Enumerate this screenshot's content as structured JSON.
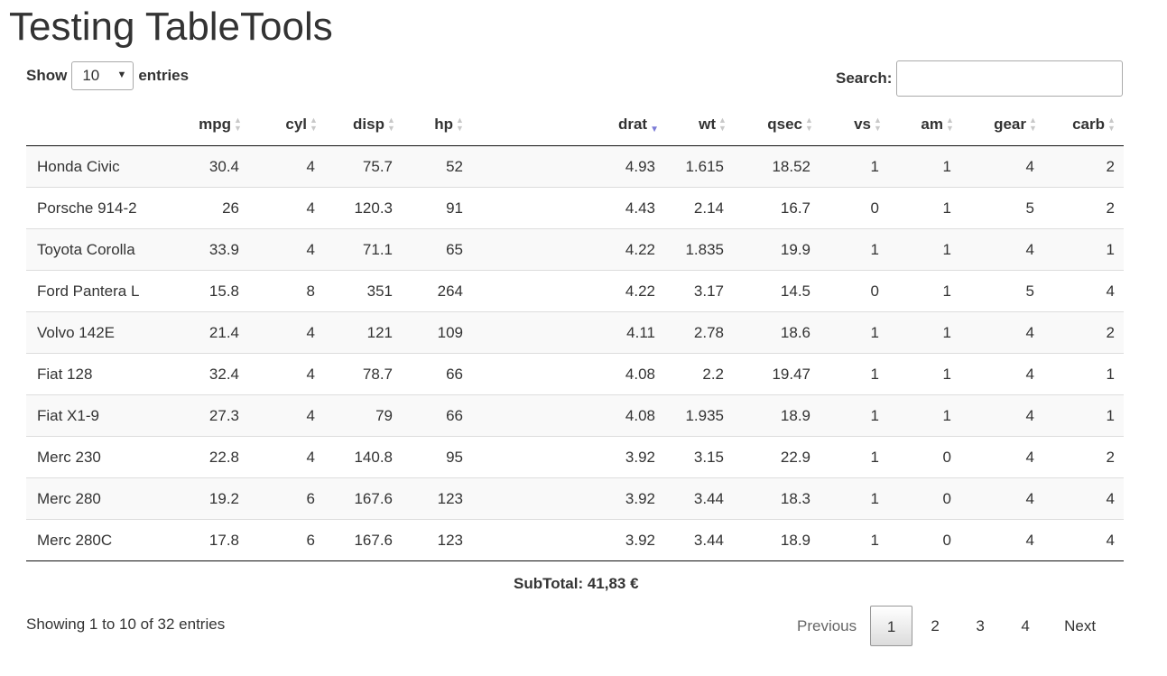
{
  "page": {
    "title": "Testing TableTools"
  },
  "length": {
    "label_show": "Show",
    "value": "10",
    "label_entries": "entries"
  },
  "search": {
    "label": "Search:",
    "value": ""
  },
  "table": {
    "columns": [
      "",
      "mpg",
      "cyl",
      "disp",
      "hp",
      "drat",
      "wt",
      "qsec",
      "vs",
      "am",
      "gear",
      "carb"
    ],
    "sorted_column": "drat",
    "sort_direction": "descending",
    "rows": [
      [
        "Honda Civic",
        "30.4",
        "4",
        "75.7",
        "52",
        "4.93",
        "1.615",
        "18.52",
        "1",
        "1",
        "4",
        "2"
      ],
      [
        "Porsche 914-2",
        "26",
        "4",
        "120.3",
        "91",
        "4.43",
        "2.14",
        "16.7",
        "0",
        "1",
        "5",
        "2"
      ],
      [
        "Toyota Corolla",
        "33.9",
        "4",
        "71.1",
        "65",
        "4.22",
        "1.835",
        "19.9",
        "1",
        "1",
        "4",
        "1"
      ],
      [
        "Ford Pantera L",
        "15.8",
        "8",
        "351",
        "264",
        "4.22",
        "3.17",
        "14.5",
        "0",
        "1",
        "5",
        "4"
      ],
      [
        "Volvo 142E",
        "21.4",
        "4",
        "121",
        "109",
        "4.11",
        "2.78",
        "18.6",
        "1",
        "1",
        "4",
        "2"
      ],
      [
        "Fiat 128",
        "32.4",
        "4",
        "78.7",
        "66",
        "4.08",
        "2.2",
        "19.47",
        "1",
        "1",
        "4",
        "1"
      ],
      [
        "Fiat X1-9",
        "27.3",
        "4",
        "79",
        "66",
        "4.08",
        "1.935",
        "18.9",
        "1",
        "1",
        "4",
        "1"
      ],
      [
        "Merc 230",
        "22.8",
        "4",
        "140.8",
        "95",
        "3.92",
        "3.15",
        "22.9",
        "1",
        "0",
        "4",
        "2"
      ],
      [
        "Merc 280",
        "19.2",
        "6",
        "167.6",
        "123",
        "3.92",
        "3.44",
        "18.3",
        "1",
        "0",
        "4",
        "4"
      ],
      [
        "Merc 280C",
        "17.8",
        "6",
        "167.6",
        "123",
        "3.92",
        "3.44",
        "18.9",
        "1",
        "0",
        "4",
        "4"
      ]
    ]
  },
  "subtotal": "SubTotal: 41,83 €",
  "info": "Showing 1 to 10 of 32 entries",
  "pagination": {
    "previous": "Previous",
    "pages": [
      "1",
      "2",
      "3",
      "4"
    ],
    "current": "1",
    "next": "Next"
  },
  "colors": {
    "sort_active": "#7b7bd6",
    "sort_inactive": "#c8c8c8",
    "stripe": "#f9f9f9"
  }
}
